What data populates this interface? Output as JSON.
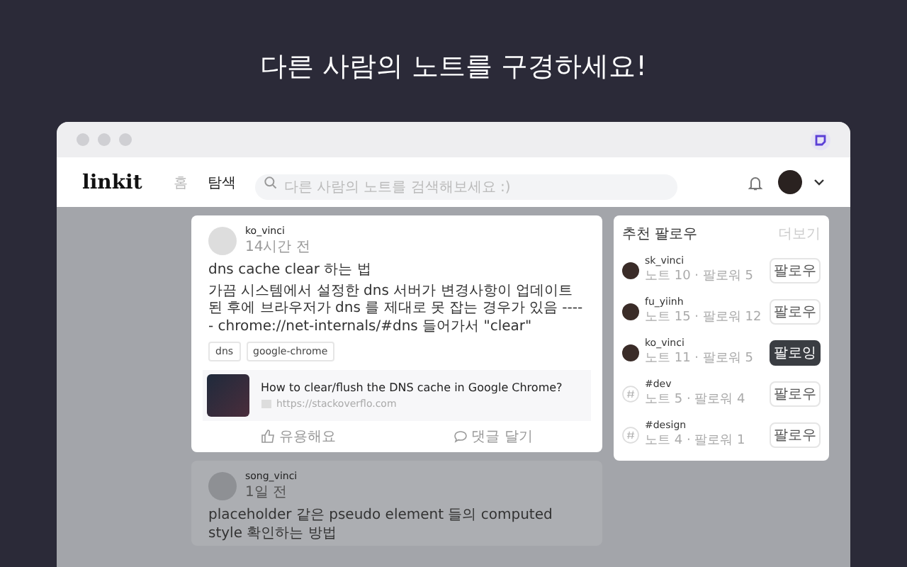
{
  "headline": "다른 사람의 노트를 구경하세요!",
  "nav": {
    "logo": "linkit",
    "tabs": [
      {
        "label": "홈",
        "selected": false
      },
      {
        "label": "탐색",
        "selected": true
      }
    ],
    "search": {
      "placeholder": "다른 사람의 노트를 검색해보세요 :)"
    }
  },
  "post": {
    "author": "ko_vinci",
    "time": "14시간 전",
    "title": "dns cache clear 하는 법",
    "body": "가끔 시스템에서 설정한 dns 서버가 변경사항이 업데이트된 후에 브라우저가 dns 를 제대로 못 잡는 경우가 있음 ----- chrome://net-internals/#dns 들어가서 \"clear\"",
    "tags": [
      "dns",
      "google-chrome"
    ],
    "link": {
      "title": "How to clear/flush the DNS cache in Google Chrome?",
      "url": "https://stackoverflo.com"
    },
    "actions": [
      {
        "kind": "like",
        "label": "유용해요"
      },
      {
        "kind": "comment",
        "label": "댓글 달기"
      }
    ]
  },
  "second_post": {
    "author": "song_vinci",
    "time": "1일 전",
    "body": "placeholder 같은 pseudo element 들의 computed style 확인하는 방법"
  },
  "sidebar": {
    "title": "추천 팔로우",
    "more": "더보기",
    "items": [
      {
        "kind": "user",
        "name": "sk_vinci",
        "meta": "노트 10 · 팔로워 5",
        "button": "팔로우",
        "following": false
      },
      {
        "kind": "user",
        "name": "fu_yiinh",
        "meta": "노트 15 · 팔로워 12",
        "button": "팔로우",
        "following": false
      },
      {
        "kind": "user",
        "name": "ko_vinci",
        "meta": "노트 11 · 팔로워 5",
        "button": "팔로잉",
        "following": true
      },
      {
        "kind": "tag",
        "name": "#dev",
        "meta": "노트 5 · 팔로워 4",
        "button": "팔로우",
        "following": false
      },
      {
        "kind": "tag",
        "name": "#design",
        "meta": "노트 4 · 팔로워 1",
        "button": "팔로우",
        "following": false
      }
    ]
  }
}
